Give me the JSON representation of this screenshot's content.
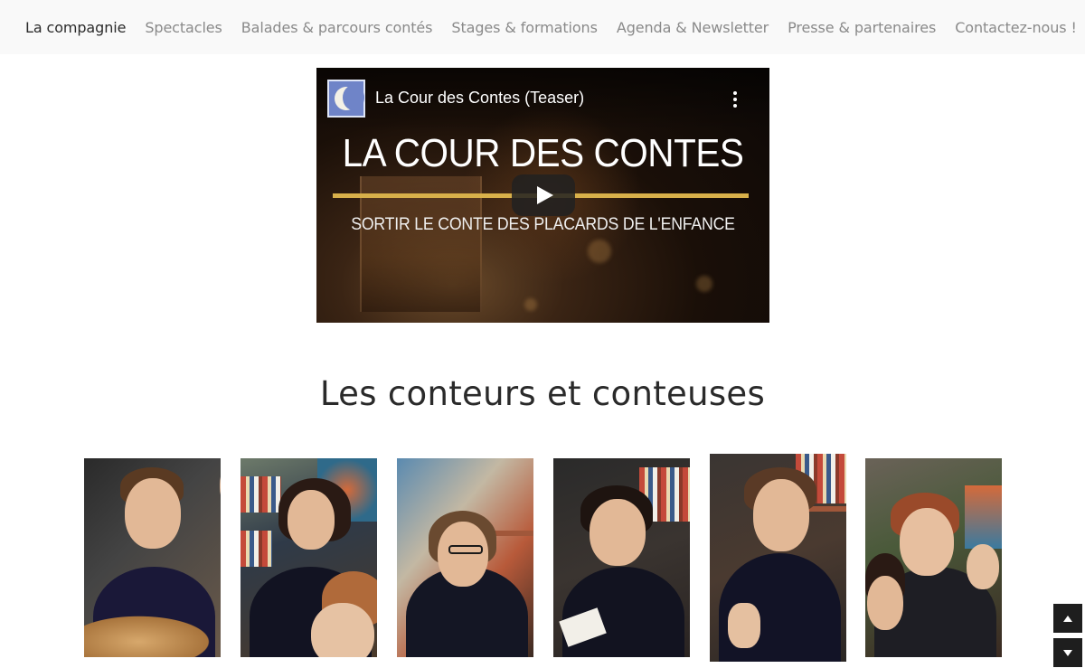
{
  "nav": {
    "items": [
      {
        "label": "La compagnie",
        "active": true
      },
      {
        "label": "Spectacles",
        "active": false
      },
      {
        "label": "Balades & parcours contés",
        "active": false
      },
      {
        "label": "Stages & formations",
        "active": false
      },
      {
        "label": "Agenda & Newsletter",
        "active": false
      },
      {
        "label": "Presse & partenaires",
        "active": false
      },
      {
        "label": "Contactez-nous !",
        "active": false
      }
    ]
  },
  "video": {
    "title": "La Cour des Contes (Teaser)",
    "headline": "LA COUR DES CONTES",
    "subtitle": "SORTIR LE CONTE DES PLACARDS DE L'ENFANCE",
    "channel_icon": "moon-logo-icon",
    "accent_color": "#d8b04a"
  },
  "section": {
    "title": "Les conteurs et conteuses"
  },
  "portraits": [
    {
      "name": "portrait-1"
    },
    {
      "name": "portrait-2"
    },
    {
      "name": "portrait-3"
    },
    {
      "name": "portrait-4"
    },
    {
      "name": "portrait-5"
    },
    {
      "name": "portrait-6"
    }
  ],
  "scroll": {
    "up_icon": "arrow-up-icon",
    "down_icon": "arrow-down-icon"
  }
}
